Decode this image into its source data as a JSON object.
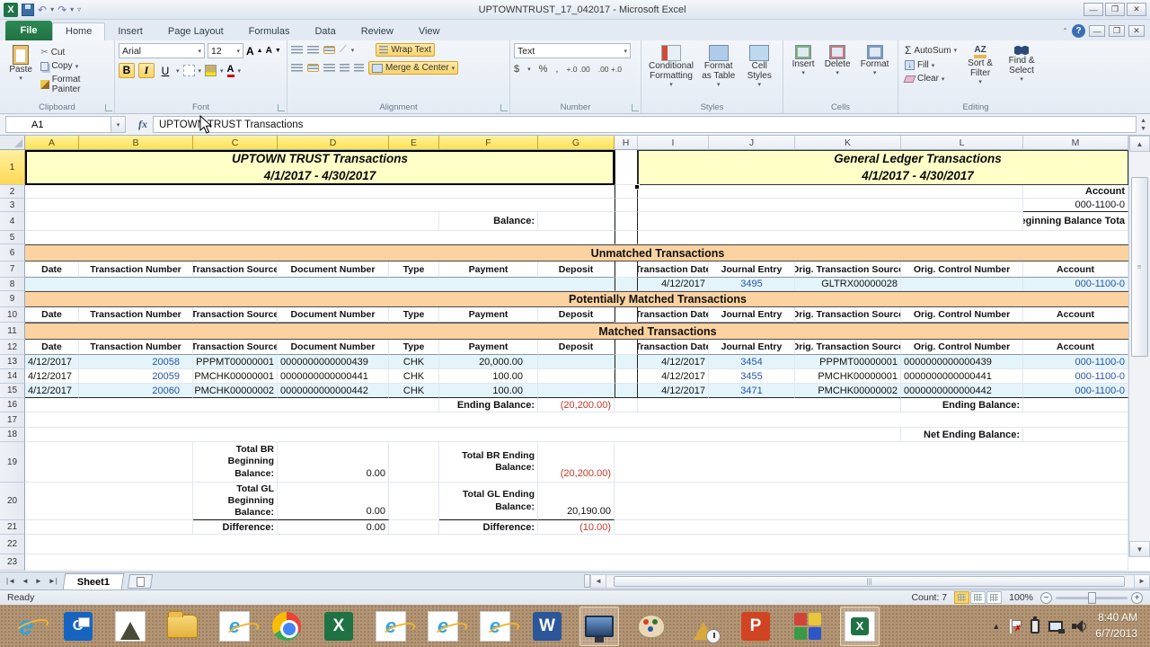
{
  "window": {
    "title": "UPTOWNTRUST_17_042017 - Microsoft Excel"
  },
  "tabs": [
    "File",
    "Home",
    "Insert",
    "Page Layout",
    "Formulas",
    "Data",
    "Review",
    "View"
  ],
  "glyphs": {
    "caret": "▾",
    "up": "▲",
    "down": "▼",
    "left": "◄",
    "right": "►",
    "bold": "B",
    "italic": "I",
    "underline": "U",
    "sigma": "Σ",
    "dollar": "$",
    "percent": "%",
    "comma": ",",
    "fx": "fx",
    "grow": "A",
    "shrink": "A",
    "cut": "✂",
    "help": "?",
    "ie": "e",
    "outlook": "O",
    "excel": "X",
    "word": "W",
    "ppt": "P",
    "min": "—",
    "close": "✕",
    "restore": "❐",
    "az": "AZ"
  },
  "ribbon": {
    "clipboard": {
      "label": "Clipboard",
      "paste": "Paste",
      "cut": "Cut",
      "copy": "Copy",
      "format_painter": "Format Painter"
    },
    "font": {
      "label": "Font",
      "family": "Arial",
      "size": "12"
    },
    "alignment": {
      "label": "Alignment",
      "wrap": "Wrap Text",
      "merge": "Merge & Center"
    },
    "number": {
      "label": "Number",
      "format": "Text"
    },
    "styles": {
      "label": "Styles",
      "conditional": "Conditional Formatting",
      "as_table": "Format as Table",
      "cell_styles": "Cell Styles"
    },
    "cells": {
      "label": "Cells",
      "insert": "Insert",
      "delete": "Delete",
      "format": "Format"
    },
    "editing": {
      "label": "Editing",
      "autosum": "AutoSum",
      "fill": "Fill",
      "clear": "Clear",
      "sort": "Sort & Filter",
      "find": "Find & Select"
    }
  },
  "formula_bar": {
    "name_box": "A1",
    "value": "UPTOWN TRUST Transactions"
  },
  "columns": [
    "A",
    "B",
    "C",
    "D",
    "E",
    "F",
    "G",
    "H",
    "I",
    "J",
    "K",
    "L",
    "M"
  ],
  "rows": [
    "1",
    "2",
    "3",
    "4",
    "5",
    "6",
    "7",
    "8",
    "9",
    "10",
    "11",
    "12",
    "13",
    "14",
    "15",
    "16",
    "17",
    "18",
    "19",
    "20",
    "21",
    "22",
    "23"
  ],
  "sheet": {
    "left_title": {
      "line1": "UPTOWN TRUST Transactions",
      "line2": "4/1/2017 - 4/30/2017"
    },
    "right_title": {
      "line1": "General Ledger Transactions",
      "line2": "4/1/2017 - 4/30/2017"
    },
    "labels": {
      "balance": "Balance:",
      "account": "Account",
      "account_num": "000-1100-0",
      "beginning_balance": "Beginning Balance Tota"
    },
    "sections": {
      "unmatched": "Unmatched Transactions",
      "potential": "Potentially Matched Transactions",
      "matched": "Matched Transactions"
    },
    "left_headers": [
      "Date",
      "Transaction Number",
      "Transaction Source",
      "Document Number",
      "Type",
      "Payment",
      "Deposit"
    ],
    "right_headers": [
      "Transaction Date",
      "Journal Entry",
      "Orig. Transaction Source",
      "Orig. Control Number",
      "Account"
    ],
    "right_unmatched_row": {
      "date": "4/12/2017",
      "journal": "3495",
      "source": "GLTRX00000028",
      "account": "000-1100-0"
    },
    "left_rows": [
      {
        "date": "4/12/2017",
        "txn": "20058",
        "source": "PPPMT00000001",
        "doc": "0000000000000439",
        "type": "CHK",
        "payment": "20,000.00"
      },
      {
        "date": "4/12/2017",
        "txn": "20059",
        "source": "PMCHK00000001",
        "doc": "0000000000000441",
        "type": "CHK",
        "payment": "100.00"
      },
      {
        "date": "4/12/2017",
        "txn": "20060",
        "source": "PMCHK00000002",
        "doc": "0000000000000442",
        "type": "CHK",
        "payment": "100.00"
      }
    ],
    "right_rows": [
      {
        "date": "4/12/2017",
        "journal": "3454",
        "source": "PPPMT00000001",
        "control": "0000000000000439",
        "account": "000-1100-0"
      },
      {
        "date": "4/12/2017",
        "journal": "3455",
        "source": "PMCHK00000001",
        "control": "0000000000000441",
        "account": "000-1100-0"
      },
      {
        "date": "4/12/2017",
        "journal": "3471",
        "source": "PMCHK00000002",
        "control": "0000000000000442",
        "account": "000-1100-0"
      }
    ],
    "totals": {
      "ending_balance_label": "Ending Balance:",
      "ending_balance_value": "(20,200.00)",
      "net_ending_label": "Net Ending Balance:",
      "br_begin_label": "Total BR Beginning Balance:",
      "br_begin_value": "0.00",
      "br_end_label": "Total BR Ending Balance:",
      "br_end_value": "(20,200.00)",
      "gl_begin_label": "Total GL Beginning Balance:",
      "gl_begin_value": "0.00",
      "gl_end_label": "Total GL Ending Balance:",
      "gl_end_value": "20,190.00",
      "diff_label": "Difference:",
      "diff_left_value": "0.00",
      "diff_right_value": "(10.00)"
    }
  },
  "tabs_bar": {
    "sheet1": "Sheet1"
  },
  "status": {
    "ready": "Ready",
    "count": "Count: 7",
    "zoom": "100%"
  },
  "taskbar": {
    "time": "8:40 AM",
    "date": "6/7/2013"
  }
}
